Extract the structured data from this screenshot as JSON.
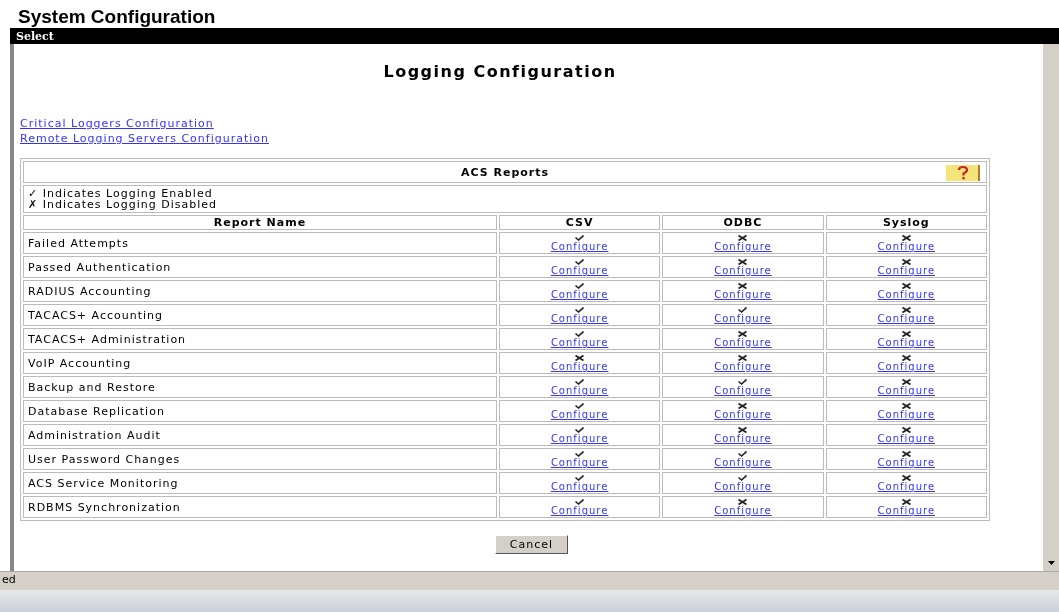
{
  "page_title": "System Configuration",
  "frame": {
    "title": "Select",
    "heading": "Logging Configuration",
    "links": [
      "Critical Loggers Configuration",
      "Remote Logging Servers Configuration"
    ],
    "table": {
      "title": "ACS Reports",
      "legend": [
        {
          "glyph": "✓",
          "text": "Indicates Logging Enabled"
        },
        {
          "glyph": "✗",
          "text": "Indicates Logging Disabled"
        }
      ],
      "columns": [
        "Report Name",
        "CSV",
        "ODBC",
        "Syslog"
      ],
      "rows": [
        {
          "cells": [
            {
              "kind": "text",
              "text": "Failed Attempts"
            },
            {
              "kind": "status",
              "enabled": true,
              "link": "Configure"
            },
            {
              "kind": "status",
              "enabled": false,
              "link": "Configure"
            },
            {
              "kind": "status",
              "enabled": false,
              "link": "Configure"
            }
          ]
        },
        {
          "cells": [
            {
              "kind": "text",
              "text": "Passed Authentication"
            },
            {
              "kind": "status",
              "enabled": true,
              "link": "Configure"
            },
            {
              "kind": "status",
              "enabled": false,
              "link": "Configure"
            },
            {
              "kind": "status",
              "enabled": false,
              "link": "Configure"
            }
          ]
        },
        {
          "cells": [
            {
              "kind": "text",
              "text": "RADIUS Accounting"
            },
            {
              "kind": "status",
              "enabled": true,
              "link": "Configure"
            },
            {
              "kind": "status",
              "enabled": false,
              "link": "Configure"
            },
            {
              "kind": "status",
              "enabled": false,
              "link": "Configure"
            }
          ]
        },
        {
          "cells": [
            {
              "kind": "text",
              "text": "TACACS+ Accounting"
            },
            {
              "kind": "status",
              "enabled": true,
              "link": "Configure"
            },
            {
              "kind": "status",
              "enabled": true,
              "link": "Configure"
            },
            {
              "kind": "status",
              "enabled": false,
              "link": "Configure"
            }
          ]
        },
        {
          "cells": [
            {
              "kind": "text",
              "text": "TACACS+ Administration"
            },
            {
              "kind": "status",
              "enabled": true,
              "link": "Configure"
            },
            {
              "kind": "status",
              "enabled": false,
              "link": "Configure"
            },
            {
              "kind": "status",
              "enabled": false,
              "link": "Configure"
            }
          ]
        },
        {
          "cells": [
            {
              "kind": "text",
              "text": "VoIP Accounting"
            },
            {
              "kind": "status",
              "enabled": false,
              "link": "Configure"
            },
            {
              "kind": "status",
              "enabled": false,
              "link": "Configure"
            },
            {
              "kind": "status",
              "enabled": false,
              "link": "Configure"
            }
          ]
        },
        {
          "cells": [
            {
              "kind": "text",
              "text": "Backup and Restore"
            },
            {
              "kind": "status",
              "enabled": true,
              "link": "Configure"
            },
            {
              "kind": "status",
              "enabled": true,
              "link": "Configure"
            },
            {
              "kind": "status",
              "enabled": false,
              "link": "Configure"
            }
          ]
        },
        {
          "cells": [
            {
              "kind": "text",
              "text": "Database Replication"
            },
            {
              "kind": "status",
              "enabled": true,
              "link": "Configure"
            },
            {
              "kind": "status",
              "enabled": false,
              "link": "Configure"
            },
            {
              "kind": "status",
              "enabled": false,
              "link": "Configure"
            }
          ]
        },
        {
          "cells": [
            {
              "kind": "text",
              "text": "Administration Audit"
            },
            {
              "kind": "status",
              "enabled": true,
              "link": "Configure"
            },
            {
              "kind": "status",
              "enabled": false,
              "link": "Configure"
            },
            {
              "kind": "status",
              "enabled": false,
              "link": "Configure"
            }
          ]
        },
        {
          "cells": [
            {
              "kind": "text",
              "text": "User Password Changes"
            },
            {
              "kind": "status",
              "enabled": true,
              "link": "Configure"
            },
            {
              "kind": "status",
              "enabled": true,
              "link": "Configure"
            },
            {
              "kind": "status",
              "enabled": false,
              "link": "Configure"
            }
          ]
        },
        {
          "cells": [
            {
              "kind": "text",
              "text": "ACS Service Monitoring"
            },
            {
              "kind": "status",
              "enabled": true,
              "link": "Configure"
            },
            {
              "kind": "status",
              "enabled": true,
              "link": "Configure"
            },
            {
              "kind": "status",
              "enabled": false,
              "link": "Configure"
            }
          ]
        },
        {
          "cells": [
            {
              "kind": "text",
              "text": "RDBMS Synchronization"
            },
            {
              "kind": "status",
              "enabled": true,
              "link": "Configure"
            },
            {
              "kind": "status",
              "enabled": false,
              "link": "Configure"
            },
            {
              "kind": "status",
              "enabled": false,
              "link": "Configure"
            }
          ]
        }
      ]
    },
    "buttons": [
      "Cancel"
    ]
  },
  "status_bar": {
    "text": "ed"
  }
}
